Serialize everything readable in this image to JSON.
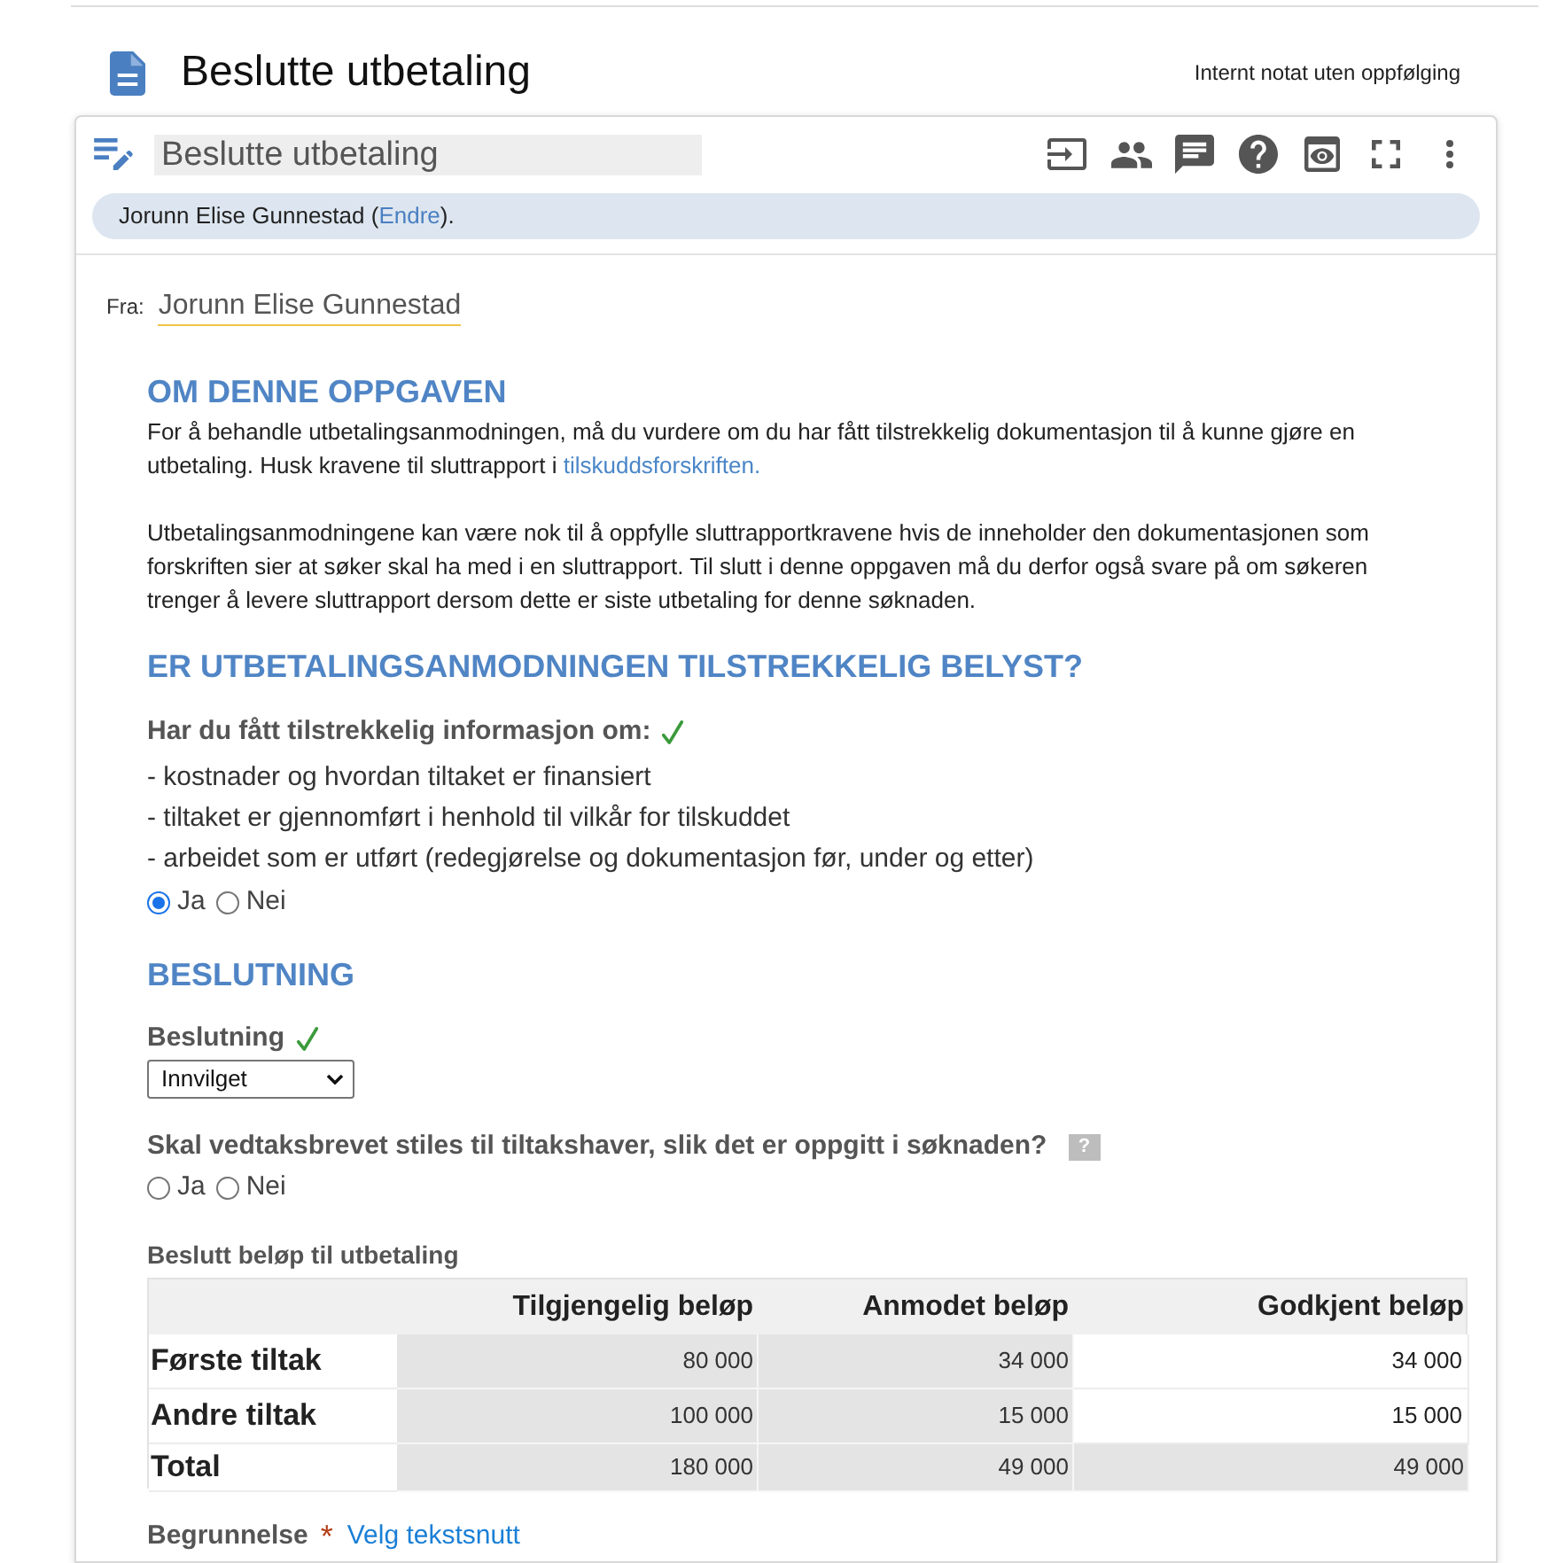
{
  "header": {
    "title": "Beslutte utbetaling",
    "note": "Internt notat uten oppfølging"
  },
  "task": {
    "title_field": {
      "value": "Beslutte utbetaling"
    },
    "assignee": {
      "name": "Jorunn Elise Gunnestad (",
      "link": "Endre",
      "suffix": ")."
    },
    "sender": {
      "label": "Fra:",
      "value": "Jorunn Elise Gunnestad"
    }
  },
  "about": {
    "heading": "OM DENNE OPPGAVEN",
    "paragraphs": [
      {
        "text": "For å behandle utbetalingsanmodningen, må du vurdere om du har fått tilstrekkelig dokumentasjon til å kunne gjøre en utbetaling. Husk kravene til sluttrapport i ",
        "link": "tilskuddsforskriften."
      },
      {
        "text": "Utbetalingsanmodningene kan være nok til å oppfylle sluttrapportkravene hvis de inneholder den dokumentasjonen som forskriften sier at søker skal ha med i en sluttrapport. Til slutt i denne oppgaven må du derfor også svare på om søkeren trenger å levere sluttrapport dersom dette er siste utbetaling for denne søknaden."
      }
    ]
  },
  "documentation": {
    "heading": "ER UTBETALINGSANMODNINGEN TILSTREKKELIG BELYST?",
    "question": {
      "label": "Har du fått tilstrekkelig informasjon om:",
      "answered": true
    },
    "items": [
      "- kostnader og hvordan tiltaket er finansiert",
      "- tiltaket er gjennomført i henhold til vilkår for tilskuddet",
      "- arbeidet som er utført (redegjørelse og dokumentasjon før, under og etter)"
    ],
    "options": [
      {
        "label": "Ja",
        "selected": true
      },
      {
        "label": "Nei",
        "selected": false
      }
    ]
  },
  "decision": {
    "heading": "BESLUTNING",
    "decision_field": {
      "label": "Beslutning",
      "answered": true,
      "value": "Innvilget"
    },
    "letter_question": {
      "label": "Skal vedtaksbrevet stiles til tiltakshaver, slik det er oppgitt i søknaden?",
      "help": "?",
      "options": [
        {
          "label": "Ja",
          "selected": false
        },
        {
          "label": "Nei",
          "selected": false
        }
      ]
    },
    "amount_table": {
      "caption": "Beslutt beløp til utbetaling",
      "columns": [
        "Tilgjengelig beløp",
        "Anmodet beløp",
        "Godkjent beløp"
      ],
      "rows": [
        {
          "kind": "item",
          "label": "Første tiltak",
          "values": [
            "80 000",
            "34 000",
            "34 000"
          ]
        },
        {
          "kind": "item",
          "label": "Andre tiltak",
          "values": [
            "100 000",
            "15 000",
            "15 000"
          ]
        },
        {
          "kind": "total",
          "label": "Total",
          "values": [
            "180 000",
            "49 000",
            "49 000"
          ]
        }
      ]
    },
    "justification": {
      "label": "Begrunnelse",
      "required_mark": "*",
      "link": "Velg tekstsnutt"
    }
  }
}
